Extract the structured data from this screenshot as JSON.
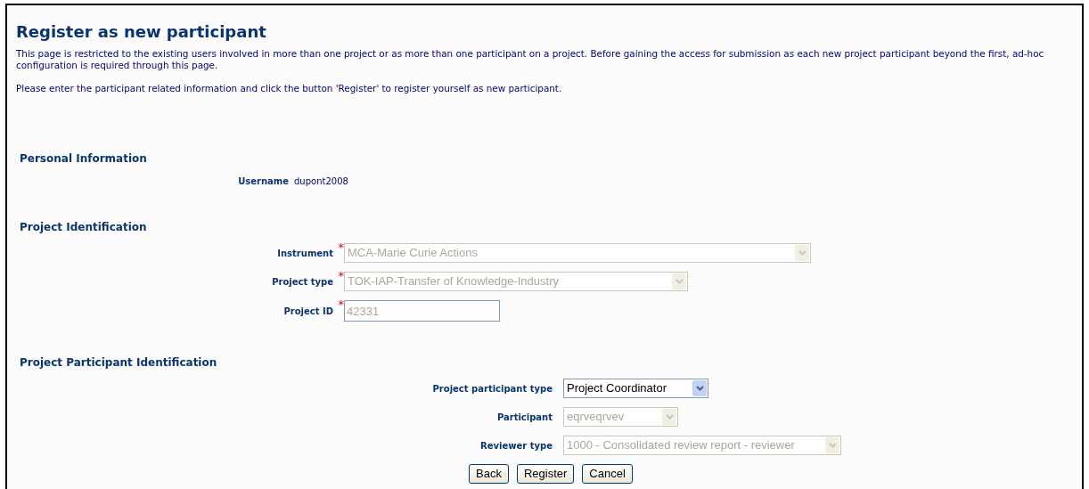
{
  "title": "Register as new participant",
  "intro": [
    "This page is restricted to the existing users involved in more than one project or as more than one participant on a project. Before gaining the access for submission as each new project participant beyond the first, ad-hoc configuration is required through this page.",
    "Please enter the participant related information and click the button 'Register' to register yourself as new participant."
  ],
  "sections": [
    {
      "heading": "Personal Information",
      "fields": [
        {
          "kind": "static",
          "label": "Username",
          "value": "dupont2008"
        }
      ]
    },
    {
      "heading": "Project Identification",
      "fields": [
        {
          "kind": "select",
          "label": "Instrument",
          "required_mark": "*",
          "disabled": true,
          "value": "MCA-Marie Curie Actions"
        },
        {
          "kind": "select",
          "label": "Project type",
          "required_mark": "*",
          "disabled": true,
          "value": "TOK-IAP-Transfer of Knowledge-Industry"
        },
        {
          "kind": "text",
          "label": "Project ID",
          "required_mark": "*",
          "disabled": true,
          "value": "42331"
        }
      ]
    },
    {
      "heading": "Project Participant Identification",
      "fields": [
        {
          "kind": "select",
          "label": "Project participant type",
          "disabled": false,
          "value": "Project Coordinator"
        },
        {
          "kind": "select",
          "label": "Participant",
          "disabled": true,
          "value": "eqrveqrvev"
        },
        {
          "kind": "select",
          "label": "Reviewer type",
          "disabled": true,
          "value": "1000 - Consolidated review report - reviewer"
        }
      ]
    }
  ],
  "buttons": [
    "Back",
    "Register",
    "Cancel"
  ]
}
